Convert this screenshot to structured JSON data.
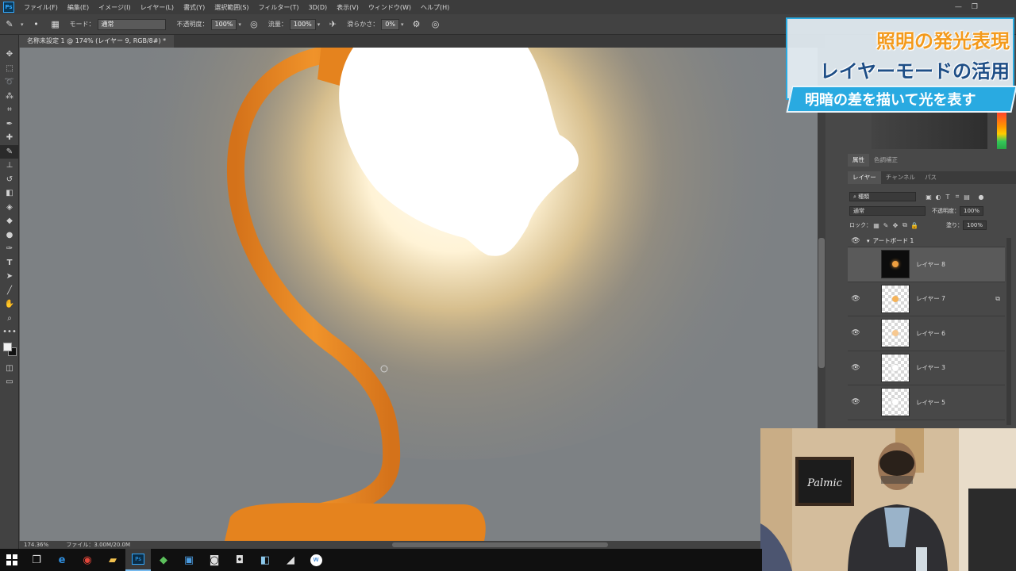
{
  "menu": {
    "items": [
      "ファイル(F)",
      "編集(E)",
      "イメージ(I)",
      "レイヤー(L)",
      "書式(Y)",
      "選択範囲(S)",
      "フィルター(T)",
      "3D(D)",
      "表示(V)",
      "ウィンドウ(W)",
      "ヘルプ(H)"
    ]
  },
  "options": {
    "mode_label": "モード：",
    "mode_value": "通常",
    "opacity_label": "不透明度：",
    "opacity_value": "100%",
    "flow_label": "流量：",
    "flow_value": "100%",
    "smoothing_label": "滑らかさ：",
    "smoothing_value": "0%"
  },
  "document": {
    "tab_title": "名称未設定 1 @ 174% (レイヤー 9, RGB/8#) *"
  },
  "status": {
    "zoom": "174.36%",
    "file": "ファイル：3.00M/20.0M"
  },
  "panels": {
    "tabs_top": [
      "属性",
      "色調補正"
    ],
    "tabs_layers": [
      "レイヤー",
      "チャンネル",
      "パス"
    ],
    "filter_kind": "種類",
    "blend_mode": "通常",
    "opacity_label": "不透明度：",
    "opacity_value": "100%",
    "lock_label": "ロック：",
    "fill_label": "塗り：",
    "fill_value": "100%",
    "artboard_name": "アートボード 1",
    "layers": [
      {
        "name": "レイヤー 8",
        "visible": false,
        "thumb": "dark",
        "dot": "#f0a040"
      },
      {
        "name": "レイヤー 7",
        "visible": true,
        "thumb": "checker",
        "dot": "#f5b35a"
      },
      {
        "name": "レイヤー 6",
        "visible": true,
        "thumb": "checker",
        "dot": "#f7c890"
      },
      {
        "name": "レイヤー 3",
        "visible": true,
        "thumb": "checker",
        "dot": "#ffffff"
      },
      {
        "name": "レイヤー 5",
        "visible": true,
        "thumb": "checker",
        "dot": "#ffffff"
      }
    ]
  },
  "overlay": {
    "line1": "照明の発光表現",
    "line2": "レイヤーモードの活用",
    "line3": "明暗の差を描いて光を表す"
  },
  "webcam": {
    "sign_text": "Palmic"
  },
  "taskbar": {
    "apps": [
      "task-view",
      "edge",
      "chrome",
      "file-explorer",
      "photoshop",
      "maps",
      "store",
      "app-7",
      "app-8",
      "app-9",
      "app-10",
      "app-11"
    ]
  },
  "colors": {
    "lamp_orange": "#e5831e",
    "glow_white": "#ffffff",
    "canvas_gray": "#7d8184",
    "overlay_orange": "#f39a1c",
    "overlay_blue": "#1e4e86",
    "overlay_band": "#29aae1"
  }
}
